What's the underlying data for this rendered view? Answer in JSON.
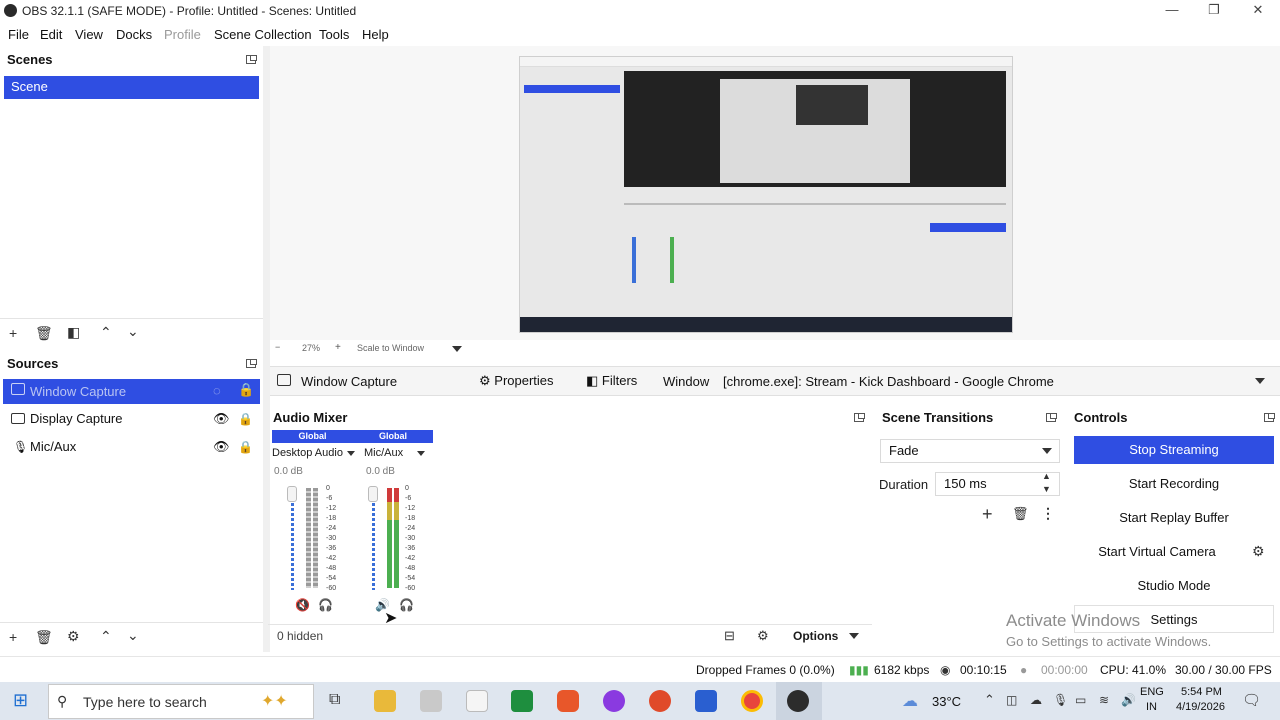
{
  "window": {
    "title": "OBS 32.1.1 (SAFE MODE) - Profile: Untitled - Scenes: Untitled",
    "minimize": "—",
    "restore": "❐",
    "close": "✕"
  },
  "menu": [
    "File",
    "Edit",
    "View",
    "Docks",
    "Profile",
    "Scene Collection",
    "Tools",
    "Help"
  ],
  "scenes": {
    "title": "Scenes",
    "items": [
      {
        "label": "Scene",
        "selected": true
      }
    ]
  },
  "sources": {
    "title": "Sources",
    "items": [
      {
        "label": "Window Capture",
        "icon": "window-icon",
        "selected": true,
        "visible": false
      },
      {
        "label": "Display Capture",
        "icon": "monitor-icon",
        "selected": false,
        "visible": true
      },
      {
        "label": "Mic/Aux",
        "icon": "microphone-icon",
        "selected": false,
        "visible": true
      }
    ]
  },
  "preview": {
    "zoom": "27%",
    "scale_mode": "Scale to Window"
  },
  "source_toolbar": {
    "source_name": "Window Capture",
    "properties": "Properties",
    "filters": "Filters",
    "window_label": "Window",
    "window_value": "[chrome.exe]: Stream - Kick Dashboard - Google Chrome"
  },
  "audio_mixer": {
    "title": "Audio Mixer",
    "channels": [
      {
        "scope": "Global",
        "name": "Desktop Audio",
        "level": "0.0 dB",
        "muted": true
      },
      {
        "scope": "Global",
        "name": "Mic/Aux",
        "level": "0.0 dB",
        "muted": false
      }
    ],
    "ticks": [
      "0",
      "-6",
      "-12",
      "-18",
      "-24",
      "-30",
      "-36",
      "-42",
      "-48",
      "-54",
      "-60"
    ],
    "hidden": "0 hidden",
    "options": "Options"
  },
  "transitions": {
    "title": "Scene Transitions",
    "selected": "Fade",
    "duration_label": "Duration",
    "duration_value": "150 ms"
  },
  "controls": {
    "title": "Controls",
    "buttons": [
      "Stop Streaming",
      "Start Recording",
      "Start Replay Buffer",
      "Start Virtual Camera",
      "Studio Mode",
      "Settings"
    ]
  },
  "watermark": {
    "line1": "Activate Windows",
    "line2": "Go to Settings to activate Windows."
  },
  "status": {
    "dropped_frames": "Dropped Frames 0 (0.0%)",
    "bitrate": "6182 kbps",
    "stream_time": "00:10:15",
    "record_time": "00:00:00",
    "cpu": "CPU: 41.0%",
    "fps": "30.00 / 30.00 FPS"
  },
  "taskbar": {
    "search_placeholder": "Type here to search",
    "weather": "33°C",
    "language": "ENG",
    "region": "IN",
    "time": "5:54 PM",
    "date": "4/19/2026"
  },
  "colors": {
    "accent": "#2f4ee2",
    "meter_green": "#4caf50",
    "meter_yellow": "#c9b23a",
    "meter_red": "#d03a3a",
    "meter_blue": "#3a6fd8"
  }
}
